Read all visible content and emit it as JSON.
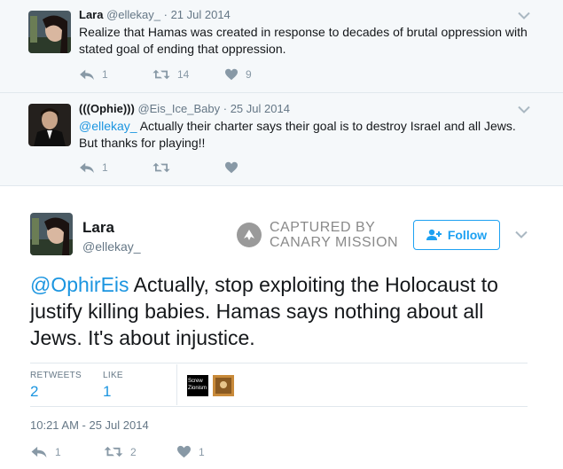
{
  "thread": [
    {
      "name": "Lara",
      "handle": "@ellekay_",
      "date": "· 21 Jul 2014",
      "text": "Realize that Hamas was created in response to decades of brutal oppression with stated goal of ending that oppression.",
      "replies": "1",
      "retweets": "14",
      "likes": "9"
    },
    {
      "name": "(((Ophie)))",
      "handle": "@Eis_Ice_Baby",
      "date": "· 25 Jul 2014",
      "mention": "@ellekay_",
      "text": " Actually their charter says their goal is to destroy Israel and all Jews. But thanks for playing!!",
      "replies": "1",
      "retweets": "",
      "likes": ""
    }
  ],
  "main": {
    "name": "Lara",
    "handle": "@ellekay_",
    "stamp_line1": "CAPTURED BY",
    "stamp_line2": "CANARY MISSION",
    "follow_label": "Follow",
    "mention": "@OphirEis",
    "text": " Actually, stop exploiting the Holocaust to justify killing babies. Hamas says nothing about all Jews. It's about injustice.",
    "retweets_label": "RETWEETS",
    "retweets_value": "2",
    "likes_label": "LIKE",
    "likes_value": "1",
    "liker1_label_a": "Screw",
    "liker1_label_b": "Zionism",
    "timestamp": "10:21 AM - 25 Jul 2014",
    "replies": "1",
    "retweets": "2",
    "likes": "1"
  },
  "colors": {
    "link": "#1b95e0",
    "follow": "#1da1f2",
    "icon": "#8899a6",
    "background": "#f5f8fa"
  },
  "icons": [
    "reply-icon",
    "retweet-icon",
    "heart-icon",
    "chevron-down-icon",
    "add-user-icon",
    "canary-stamp-icon"
  ]
}
